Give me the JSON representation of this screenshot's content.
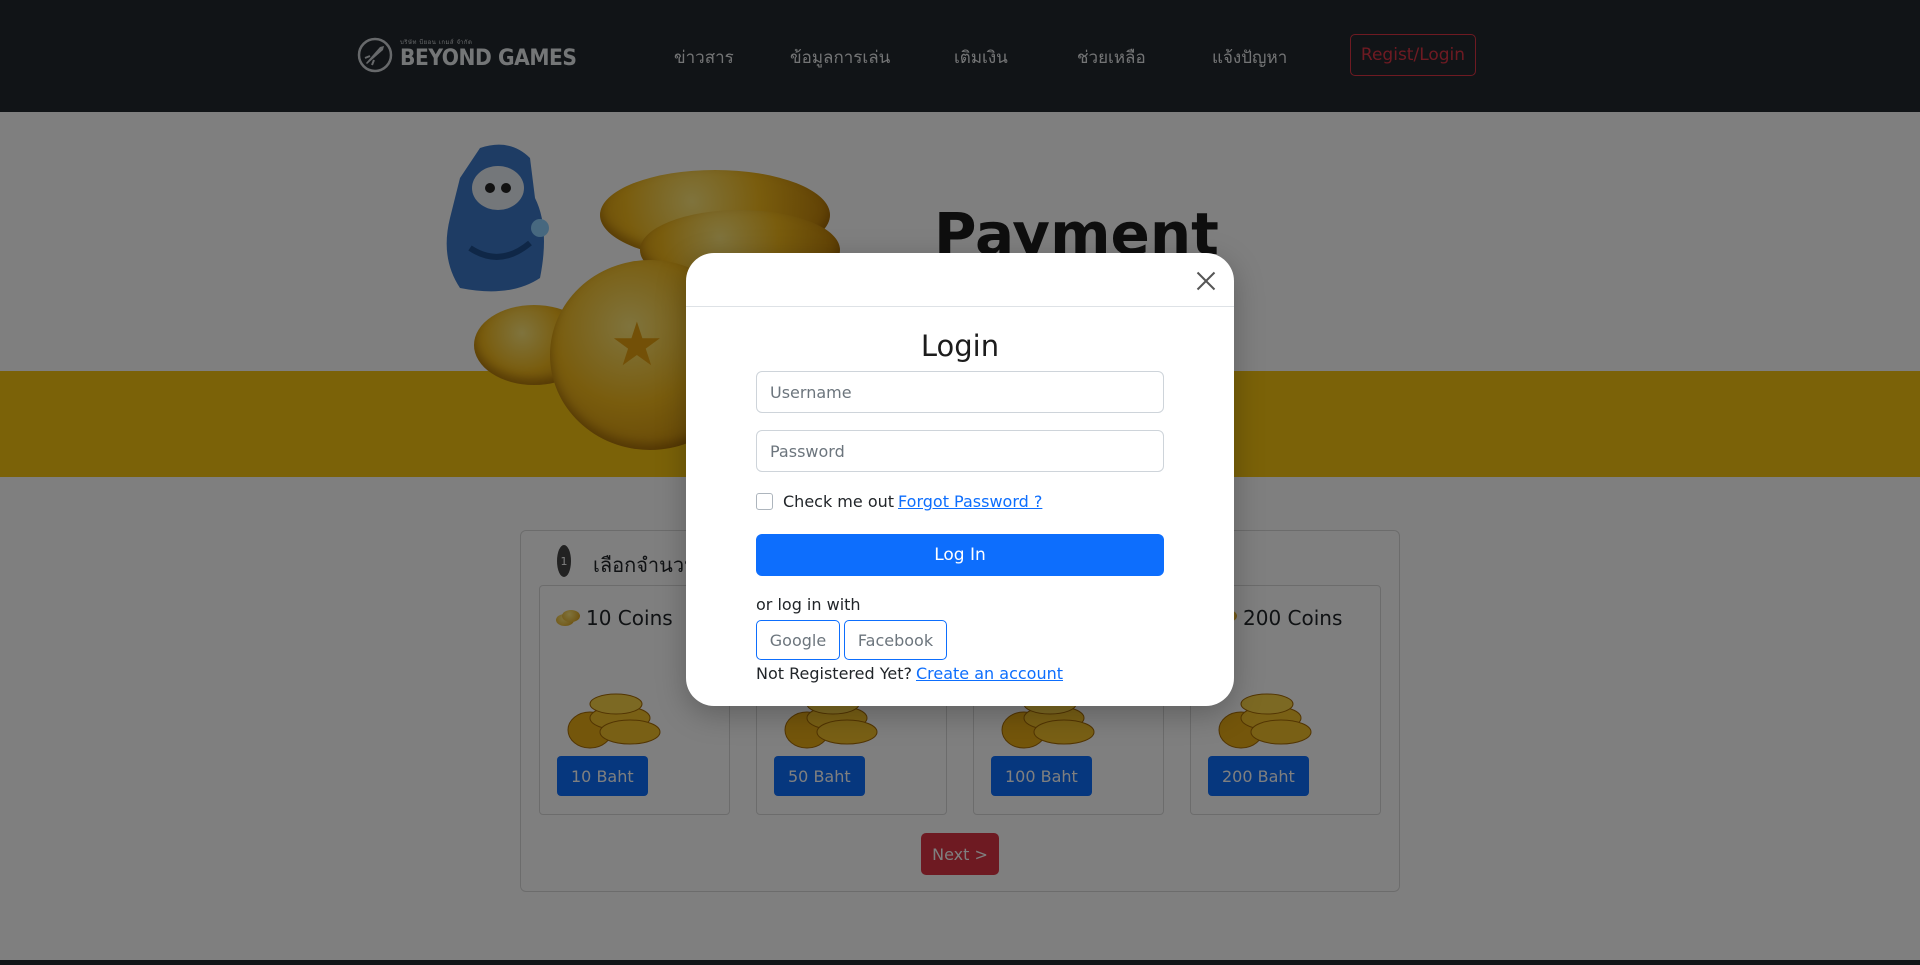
{
  "navbar": {
    "logo_small": "บริษัท บียอน เกมส์ จำกัด",
    "logo_text": "BEYOND GAMES",
    "items": [
      {
        "label": "ข่าวสาร"
      },
      {
        "label": "ข้อมูลการเล่น"
      },
      {
        "label": "เติมเงิน"
      },
      {
        "label": "ช่วยเหลือ"
      },
      {
        "label": "แจ้งปัญหา"
      }
    ],
    "login_button": "Regist/Login"
  },
  "hero": {
    "title": "Payment",
    "band_color": "#f6c511"
  },
  "selection": {
    "step_number": "1",
    "step_label": "เลือกจำนวน",
    "packages": [
      {
        "title": "10 Coins",
        "price": "10 Baht"
      },
      {
        "title": "",
        "price": "50 Baht"
      },
      {
        "title": "",
        "price": "100 Baht"
      },
      {
        "title": "200 Coins",
        "price": "200 Baht"
      }
    ],
    "next_button": "Next >"
  },
  "modal": {
    "title": "Login",
    "username_placeholder": "Username",
    "password_placeholder": "Password",
    "remember_label": "Check me out",
    "forgot_link": "Forgot Password ?",
    "login_button": "Log In",
    "or_text": "or log in with",
    "google_button": "Google",
    "facebook_button": "Facebook",
    "register_prompt": "Not Registered Yet?",
    "register_link": "Create an account"
  },
  "colors": {
    "primary": "#0d6efd",
    "danger": "#dc3545",
    "navbar": "#22282e",
    "gold": "#f6c511"
  }
}
